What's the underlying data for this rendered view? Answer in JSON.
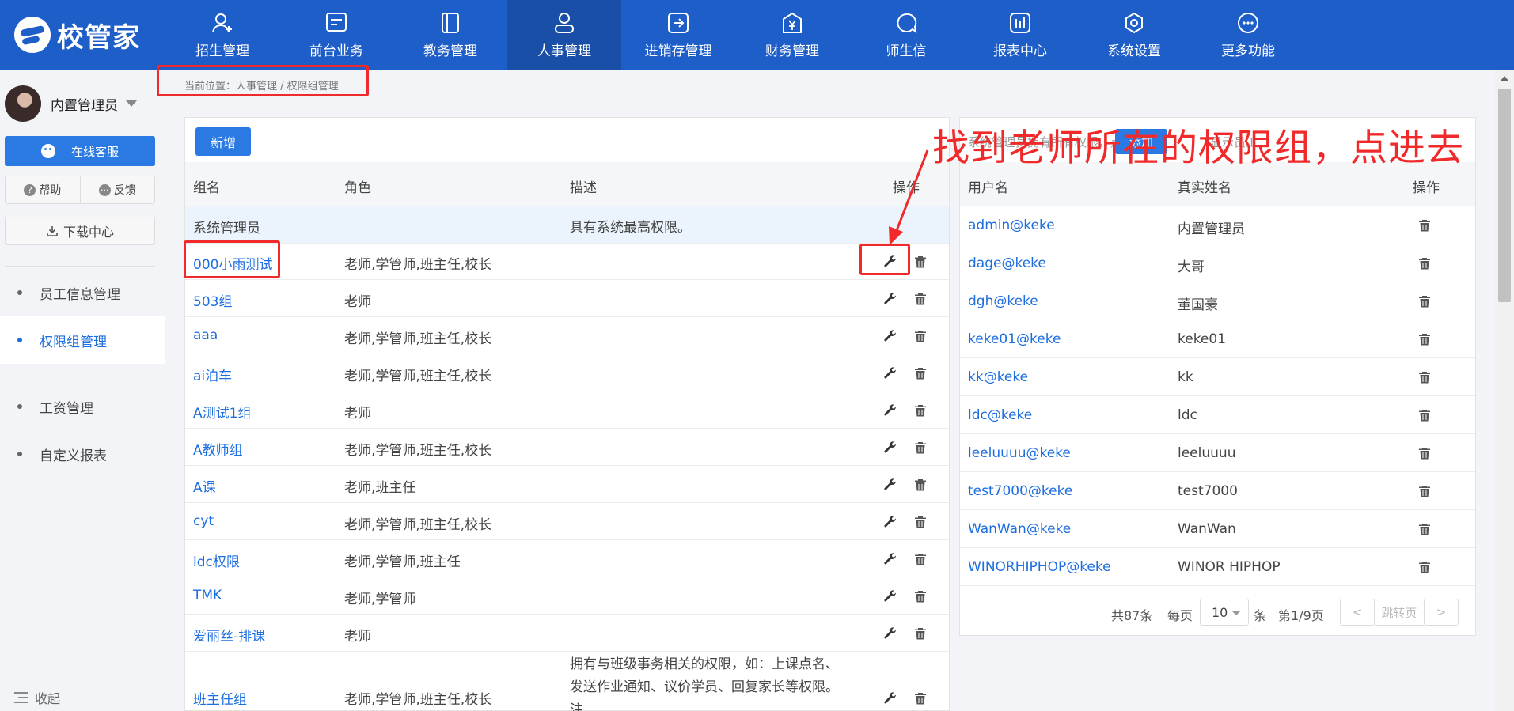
{
  "app": {
    "logo_text": "校管家"
  },
  "nav": [
    {
      "label": "招生管理",
      "icon": "user-plus-icon"
    },
    {
      "label": "前台业务",
      "icon": "monitor-icon"
    },
    {
      "label": "教务管理",
      "icon": "book-icon"
    },
    {
      "label": "人事管理",
      "icon": "person-icon",
      "active": true
    },
    {
      "label": "进销存管理",
      "icon": "box-arrow-icon"
    },
    {
      "label": "财务管理",
      "icon": "yuan-icon"
    },
    {
      "label": "师生信",
      "icon": "chat-icon"
    },
    {
      "label": "报表中心",
      "icon": "report-icon"
    },
    {
      "label": "系统设置",
      "icon": "settings-icon"
    },
    {
      "label": "更多功能",
      "icon": "more-icon"
    }
  ],
  "sidebar": {
    "user_name": "内置管理员",
    "service_btn": "在线客服",
    "help": "帮助",
    "feedback": "反馈",
    "download": "下载中心",
    "menu": [
      {
        "label": "员工信息管理"
      },
      {
        "label": "权限组管理",
        "active": true
      },
      {
        "label": "工资管理"
      },
      {
        "label": "自定义报表"
      }
    ],
    "collapse": "收起"
  },
  "breadcrumb": "当前位置：人事管理 / 权限组管理",
  "groups": {
    "add_btn": "新增",
    "headers": {
      "name": "组名",
      "role": "角色",
      "desc": "描述",
      "op": "操作"
    },
    "rows": [
      {
        "name": "系统管理员",
        "role": "",
        "desc": "具有系统最高权限。",
        "system": true
      },
      {
        "name": "000小雨测试",
        "role": "老师,学管师,班主任,校长",
        "desc": ""
      },
      {
        "name": "503组",
        "role": "老师",
        "desc": ""
      },
      {
        "name": "aaa",
        "role": "老师,学管师,班主任,校长",
        "desc": ""
      },
      {
        "name": "ai泊车",
        "role": "老师,学管师,班主任,校长",
        "desc": ""
      },
      {
        "name": "A测试1组",
        "role": "老师",
        "desc": ""
      },
      {
        "name": "A教师组",
        "role": "老师,学管师,班主任,校长",
        "desc": ""
      },
      {
        "name": "A课",
        "role": "老师,班主任",
        "desc": ""
      },
      {
        "name": "cyt",
        "role": "老师,学管师,班主任,校长",
        "desc": ""
      },
      {
        "name": "ldc权限",
        "role": "老师,学管师,班主任",
        "desc": ""
      },
      {
        "name": "TMK",
        "role": "老师,学管师",
        "desc": ""
      },
      {
        "name": "爱丽丝-排课",
        "role": "老师",
        "desc": ""
      },
      {
        "name": "班主任组",
        "role": "老师,学管师,班主任,校长",
        "desc": "拥有与班级事务相关的权限，如：上课点名、发送作业通知、议价学员、回复家长等权限。注"
      }
    ]
  },
  "members": {
    "header_hint": "系统管理员拥有所有权限，点击",
    "add_btn": "添加",
    "header_hint2": "显示员工",
    "headers": {
      "user": "用户名",
      "real": "真实姓名",
      "op": "操作"
    },
    "rows": [
      {
        "user": "admin@keke",
        "real": "内置管理员"
      },
      {
        "user": "dage@keke",
        "real": "大哥"
      },
      {
        "user": "dgh@keke",
        "real": "董国豪"
      },
      {
        "user": "keke01@keke",
        "real": "keke01"
      },
      {
        "user": "kk@keke",
        "real": "kk"
      },
      {
        "user": "ldc@keke",
        "real": "ldc"
      },
      {
        "user": "leeluuuu@keke",
        "real": "leeluuuu"
      },
      {
        "user": "test7000@keke",
        "real": "test7000"
      },
      {
        "user": "WanWan@keke",
        "real": "WanWan"
      },
      {
        "user": "WINORHIPHOP@keke",
        "real": "WINOR HIPHOP"
      }
    ],
    "pager": {
      "total": "共87条",
      "per_page_label": "每页",
      "per_page": "10",
      "unit": "条",
      "page": "第1/9页",
      "jump": "跳转页",
      "prev": "<",
      "next": ">"
    }
  },
  "annotation": {
    "text": "找到老师所在的权限组，点进去",
    "color": "#f02a2a"
  },
  "colors": {
    "brand": "#1d5ec9",
    "link": "#1d6ee0",
    "button": "#2b7ae4"
  }
}
